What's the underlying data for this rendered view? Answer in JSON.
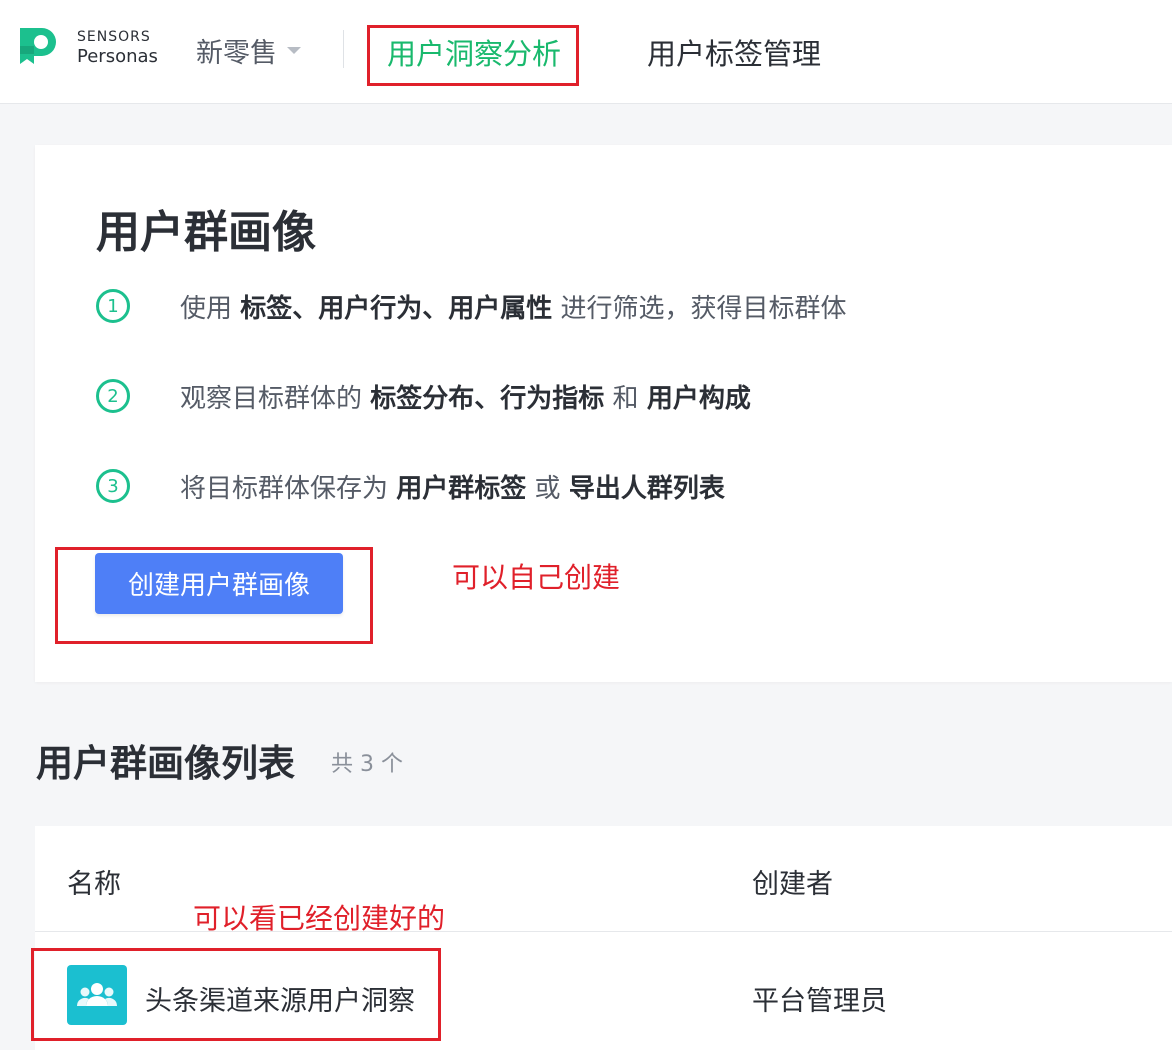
{
  "header": {
    "logo_line1": "SENSORS",
    "logo_line2": "Personas",
    "project": "新零售",
    "nav": [
      {
        "label": "用户洞察分析",
        "active": true
      },
      {
        "label": "用户标签管理",
        "active": false
      }
    ],
    "accent": "#19b96d"
  },
  "intro": {
    "title": "用户群画像",
    "steps": [
      {
        "num": "1",
        "parts": [
          {
            "t": "使用 ",
            "b": false
          },
          {
            "t": "标签、用户行为、用户属性",
            "b": true
          },
          {
            "t": " 进行筛选，获得目标群体",
            "b": false
          }
        ]
      },
      {
        "num": "2",
        "parts": [
          {
            "t": "观察目标群体的 ",
            "b": false
          },
          {
            "t": "标签分布、行为指标",
            "b": true
          },
          {
            "t": " 和 ",
            "b": false
          },
          {
            "t": "用户构成",
            "b": true
          }
        ]
      },
      {
        "num": "3",
        "parts": [
          {
            "t": "将目标群体保存为 ",
            "b": false
          },
          {
            "t": "用户群标签",
            "b": true
          },
          {
            "t": " 或 ",
            "b": false
          },
          {
            "t": "导出人群列表",
            "b": true
          }
        ]
      }
    ],
    "create_button": "创建用户群画像",
    "button_color": "#4e7ff7"
  },
  "list": {
    "title": "用户群画像列表",
    "count": "共 3 个",
    "columns": [
      "名称",
      "创建者"
    ],
    "rows": [
      {
        "icon": "users-icon",
        "name": "头条渠道来源用户洞察",
        "creator": "平台管理员"
      }
    ]
  },
  "annotations": {
    "create_note": "可以自己创建",
    "list_note": "可以看已经创建好的",
    "color": "#e0202a"
  }
}
